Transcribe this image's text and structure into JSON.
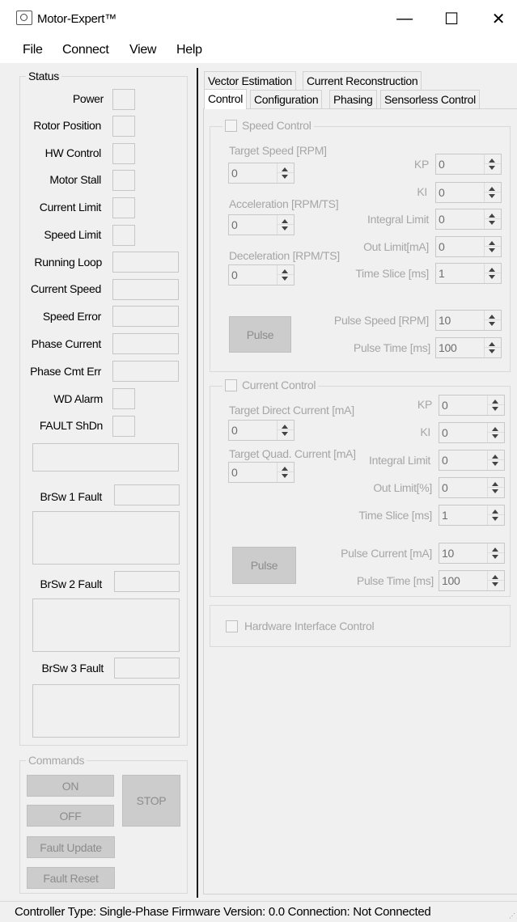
{
  "window": {
    "title": "Motor-Expert™",
    "minimize": "—",
    "maximize": "☐",
    "close": "✕"
  },
  "menu": [
    "File",
    "Connect",
    "View",
    "Help"
  ],
  "status": {
    "group_title": "Status",
    "items": [
      "Power",
      "Rotor Position",
      "HW Control",
      "Motor Stall",
      "Current Limit",
      "Speed Limit"
    ],
    "wide_items": [
      "Running Loop",
      "Current Speed",
      "Speed Error",
      "Phase Current",
      "Phase Cmt Err"
    ],
    "alarms": [
      "WD Alarm",
      "FAULT ShDn"
    ],
    "branch_faults": [
      "BrSw 1 Fault",
      "BrSw 2 Fault",
      "BrSw 3 Fault"
    ]
  },
  "commands": {
    "group_title": "Commands",
    "on": "ON",
    "off": "OFF",
    "stop": "STOP",
    "fault_update": "Fault Update",
    "fault_reset": "Fault Reset"
  },
  "tabs": {
    "row1": [
      "Vector Estimation",
      "Current Reconstruction"
    ],
    "row2": [
      "Control",
      "Configuration",
      "Phasing",
      "Sensorless Control"
    ],
    "active": "Control"
  },
  "speed_control": {
    "title": "Speed Control",
    "target_speed_label": "Target Speed [RPM]",
    "target_speed": "0",
    "accel_label": "Acceleration [RPM/TS]",
    "accel": "0",
    "decel_label": "Deceleration [RPM/TS]",
    "decel": "0",
    "kp_label": "KP",
    "kp": "0",
    "ki_label": "KI",
    "ki": "0",
    "integral_limit_label": "Integral Limit",
    "integral_limit": "0",
    "out_limit_label": "Out Limit[mA]",
    "out_limit": "0",
    "time_slice_label": "Time Slice [ms]",
    "time_slice": "1",
    "pulse_label": "Pulse",
    "pulse_speed_label": "Pulse Speed [RPM]",
    "pulse_speed": "10",
    "pulse_time_label": "Pulse Time [ms]",
    "pulse_time": "100"
  },
  "current_control": {
    "title": "Current Control",
    "target_direct_label": "Target Direct Current [mA]",
    "target_direct": "0",
    "target_quad_label": "Target Quad. Current [mA]",
    "target_quad": "0",
    "kp_label": "KP",
    "kp": "0",
    "ki_label": "KI",
    "ki": "0",
    "integral_limit_label": "Integral Limit",
    "integral_limit": "0",
    "out_limit_label": "Out Limit[%]",
    "out_limit": "0",
    "time_slice_label": "Time Slice [ms]",
    "time_slice": "1",
    "pulse_label": "Pulse",
    "pulse_current_label": "Pulse Current [mA]",
    "pulse_current": "10",
    "pulse_time_label": "Pulse Time [ms]",
    "pulse_time": "100"
  },
  "hw_interface": {
    "label": "Hardware Interface Control"
  },
  "statusbar": {
    "controller_type_label": "Controller Type:",
    "controller_type": "Single-Phase",
    "firmware_label": "Firmware Version:",
    "firmware": "0.0",
    "connection_label": "Connection:",
    "connection": "Not Connected"
  }
}
